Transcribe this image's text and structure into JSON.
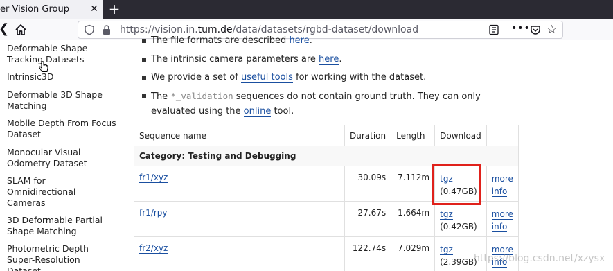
{
  "browser": {
    "tab_title": "ter Vision Group",
    "url_prefix": "https://vision.in.",
    "url_domain": "tum.de",
    "url_path": "/data/datasets/rgbd-dataset/download"
  },
  "sidebar": {
    "items": [
      {
        "label": "Deformable Shape Tracking Datasets"
      },
      {
        "label": "Intrinsic3D"
      },
      {
        "label": "Deformable 3D Shape Matching"
      },
      {
        "label": "Mobile Depth From Focus Dataset"
      },
      {
        "label": "Monocular Visual Odometry Dataset"
      },
      {
        "label": "SLAM for Omnidirectional Cameras"
      },
      {
        "label": "3D Deformable Partial Shape Matching"
      },
      {
        "label": "Photometric Depth Super-Resolution Dataset"
      }
    ]
  },
  "bullets": {
    "b1_text": "The file formats are described ",
    "b1_link": "here",
    "b1_end": ".",
    "b2_text": "The intrinsic camera parameters are ",
    "b2_link": "here",
    "b2_end": ".",
    "b3_text": "We provide a set of ",
    "b3_link": "useful tools",
    "b3_end": " for working with the dataset.",
    "b4_pre": "The ",
    "b4_code": "*_validation",
    "b4_mid": " sequences do not contain ground truth. They can only evaluated using the ",
    "b4_link": "online",
    "b4_end": " tool."
  },
  "table": {
    "headers": [
      "Sequence name",
      "Duration",
      "Length",
      "Download",
      ""
    ],
    "category": "Category: Testing and Debugging",
    "rows": [
      {
        "name": "fr1/xyz",
        "duration": "30.09s",
        "length": "7.112m",
        "download": "tgz",
        "size": "(0.47GB)",
        "more": "more",
        "info": "info"
      },
      {
        "name": "fr1/rpy",
        "duration": "27.67s",
        "length": "1.664m",
        "download": "tgz",
        "size": "(0.42GB)",
        "more": "more",
        "info": "info"
      },
      {
        "name": "fr2/xyz",
        "duration": "122.74s",
        "length": "7.029m",
        "download": "tgz",
        "size": "(2.39GB)",
        "more": "more",
        "info": "info"
      }
    ]
  },
  "watermark": "https://blog.csdn.net/xzysx",
  "colors": {
    "link": "#1a4fa0",
    "highlight": "#e0211b",
    "tabbar": "#2b2a33"
  }
}
